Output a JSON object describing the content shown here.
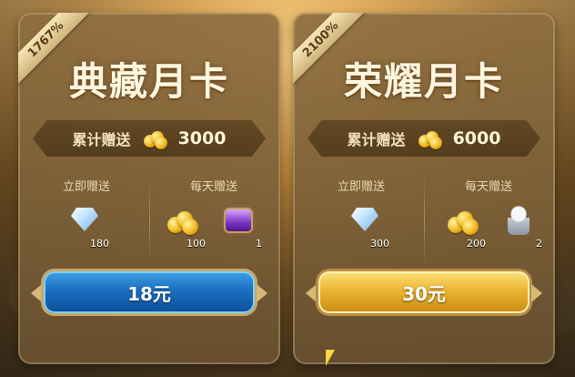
{
  "cards": [
    {
      "ribbon": "1767%",
      "title": "典藏月卡",
      "total_label": "累计赠送",
      "total_value": "3000",
      "instant_label": "立即赠送",
      "daily_label": "每天赠送",
      "instant_reward": {
        "icon": "diamond-icon",
        "qty": "180"
      },
      "daily_rewards": [
        {
          "icon": "gold-coins-icon",
          "qty": "100"
        },
        {
          "icon": "purple-chest-icon",
          "qty": "1"
        }
      ],
      "button_label": "18元",
      "button_color": "#1b6fc0"
    },
    {
      "ribbon": "2100%",
      "title": "荣耀月卡",
      "total_label": "累计赠送",
      "total_value": "6000",
      "instant_label": "立即赠送",
      "daily_label": "每天赠送",
      "instant_reward": {
        "icon": "diamond-icon",
        "qty": "300"
      },
      "daily_rewards": [
        {
          "icon": "gold-coins-icon",
          "qty": "200"
        },
        {
          "icon": "silver-bust-icon",
          "qty": "2"
        }
      ],
      "button_label": "30元",
      "button_color": "#e9b12c"
    }
  ]
}
